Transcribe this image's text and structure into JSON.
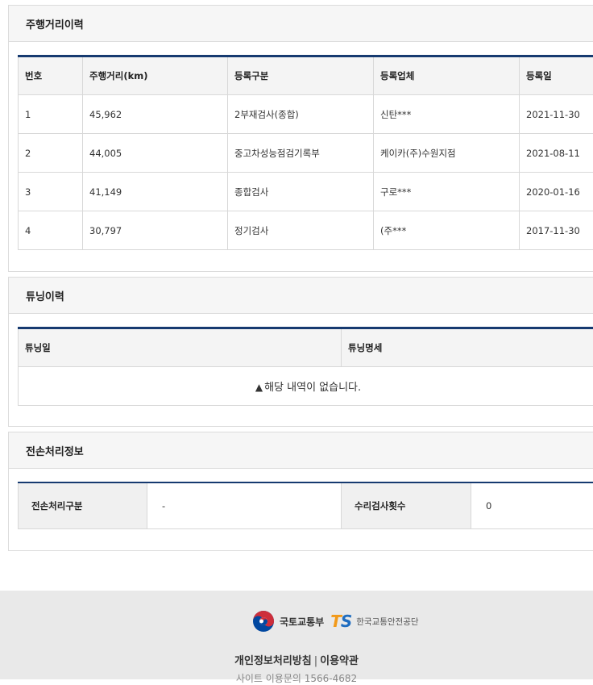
{
  "mileage": {
    "title": "주행거리이력",
    "headers": [
      "번호",
      "주행거리(km)",
      "등록구분",
      "등록업체",
      "등록일"
    ],
    "rows": [
      [
        "1",
        "45,962",
        "2부재검사(종합)",
        "신탄***",
        "2021-11-30"
      ],
      [
        "2",
        "44,005",
        "중고차성능점검기록부",
        "케이카(주)수원지점",
        "2021-08-11"
      ],
      [
        "3",
        "41,149",
        "종합검사",
        "구로***",
        "2020-01-16"
      ],
      [
        "4",
        "30,797",
        "정기검사",
        "(주***",
        "2017-11-30"
      ]
    ]
  },
  "tuning": {
    "title": "튜닝이력",
    "headers": [
      "튜닝일",
      "튜닝명세"
    ],
    "empty_icon": "warning-icon",
    "empty_message": "해당 내역이 없습니다."
  },
  "total_loss": {
    "title": "전손처리정보",
    "label1": "전손처리구분",
    "value1": "-",
    "label2": "수리검사횟수",
    "value2": "0"
  },
  "footer": {
    "ministry": "국토교통부",
    "ts_logo_t": "T",
    "ts_logo_s": "S",
    "agency": "한국교통안전공단",
    "privacy_link": "개인정보처리방침",
    "separator": "|",
    "terms_link": "이용약관",
    "contact": "사이트 이용문의 1566-4682"
  },
  "colors": {
    "table_top_border": "#163a70",
    "ts_orange": "#f29a1a",
    "ts_blue": "#1f6dc0",
    "taeguk_red": "#cd2e3a",
    "taeguk_blue": "#0047a0"
  }
}
